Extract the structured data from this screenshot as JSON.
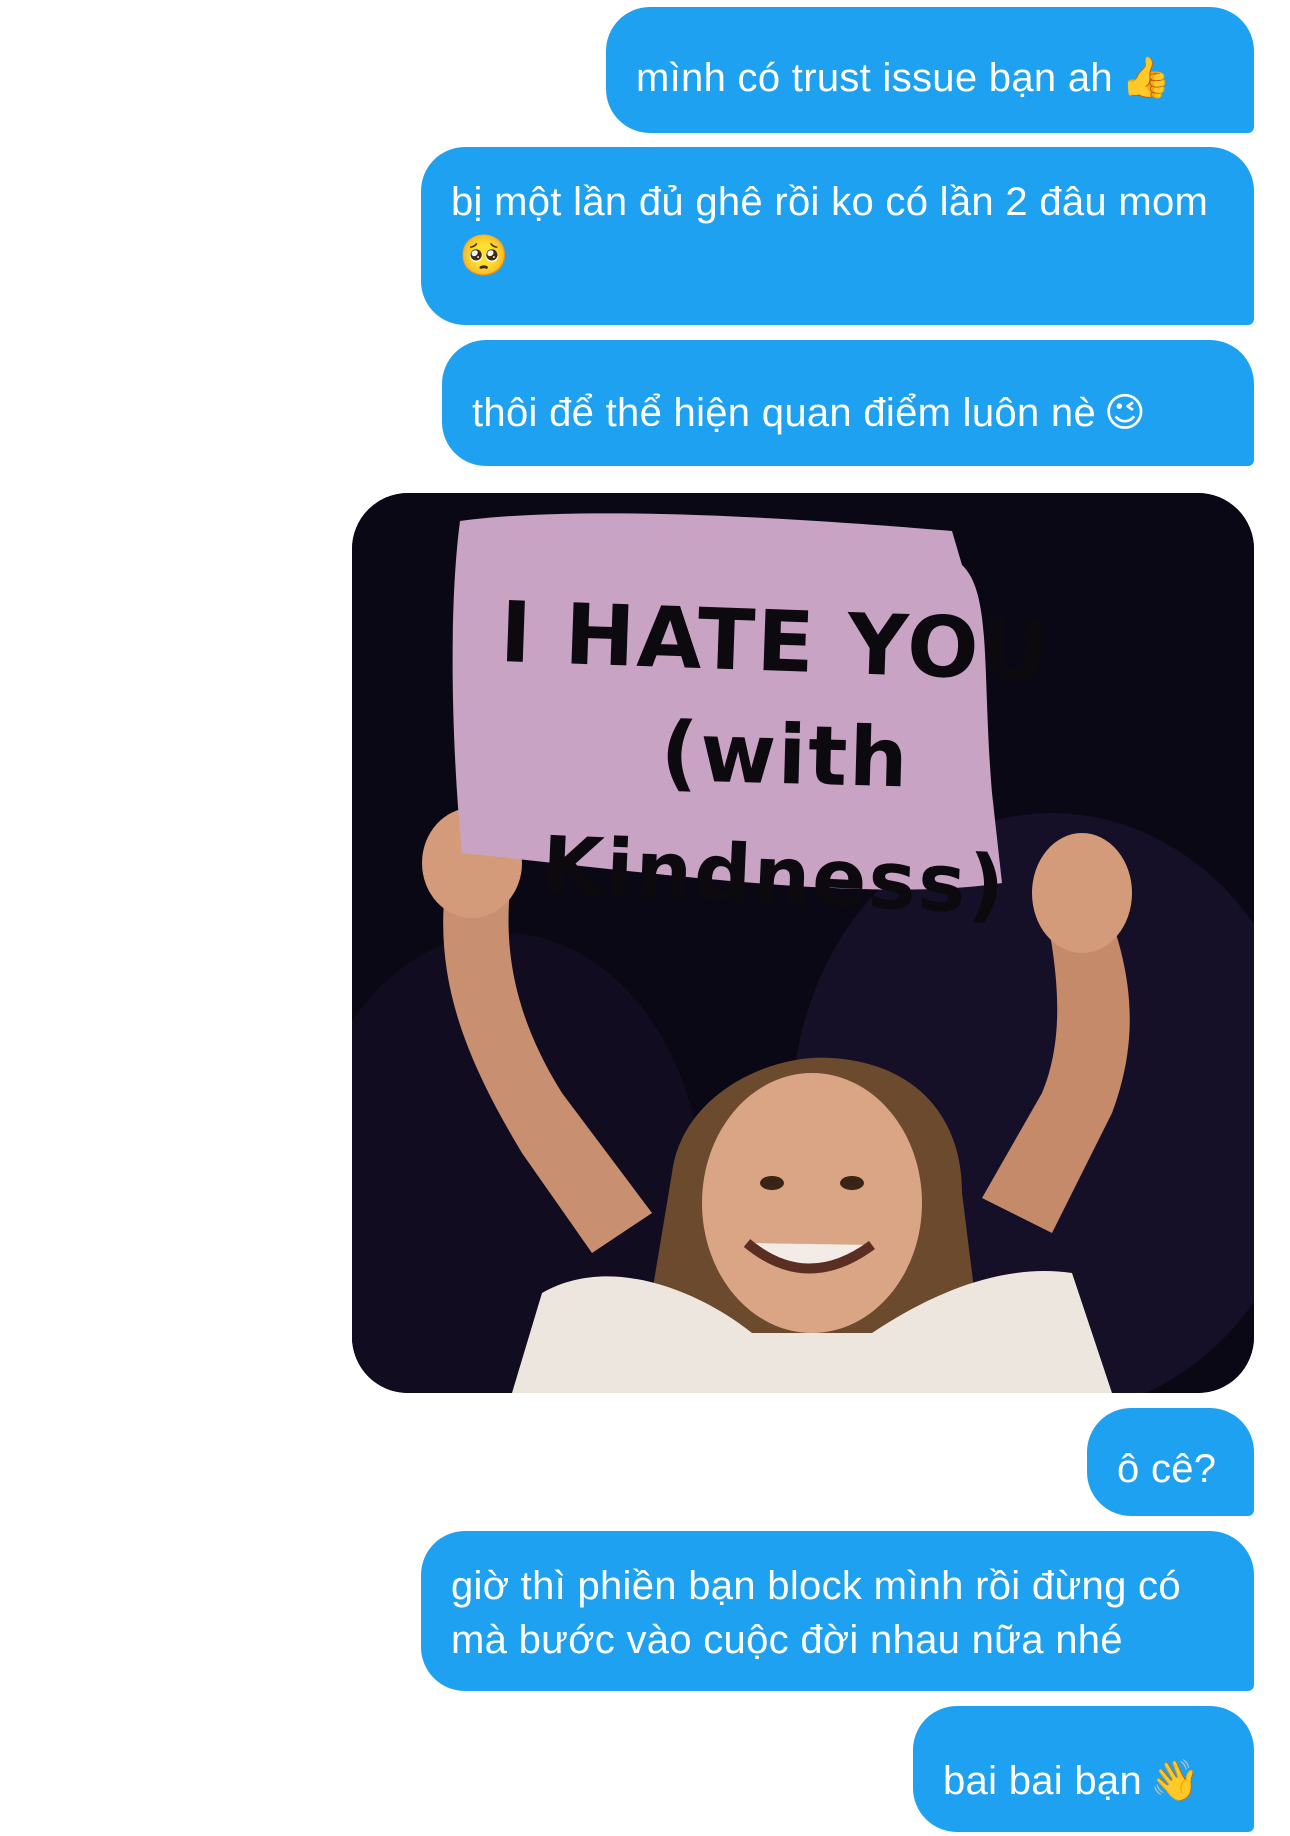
{
  "messages": [
    {
      "text": "mình có trust issue bạn ah",
      "emoji": "👍",
      "emoji_name": "thumbs-up-icon"
    },
    {
      "text": "bị một lần đủ ghê rồi ko có lần 2 đâu mom",
      "emoji": "🥺",
      "emoji_name": "pleading-face-icon"
    },
    {
      "text": "thôi để thể hiện quan điểm luôn nè",
      "emoji": "😉",
      "emoji_name": "winking-face-icon"
    },
    {
      "text": "ô cê?",
      "emoji": "",
      "emoji_name": ""
    },
    {
      "text": "giờ thì phiền bạn block mình rồi đừng có mà bước vào cuộc đời nhau nữa nhé",
      "emoji": "",
      "emoji_name": ""
    },
    {
      "text": "bai bai bạn",
      "emoji": "👋",
      "emoji_name": "waving-hand-icon"
    }
  ],
  "image_message": {
    "sign_lines": [
      "I HATE YOU",
      "(with",
      "Kindness)"
    ]
  },
  "colors": {
    "bubble_bg": "#1fa1f1",
    "bubble_text": "#ffffff",
    "page_bg": "#ffffff",
    "sign_bg": "#c9a3c4",
    "image_bg": "#0a0814"
  }
}
